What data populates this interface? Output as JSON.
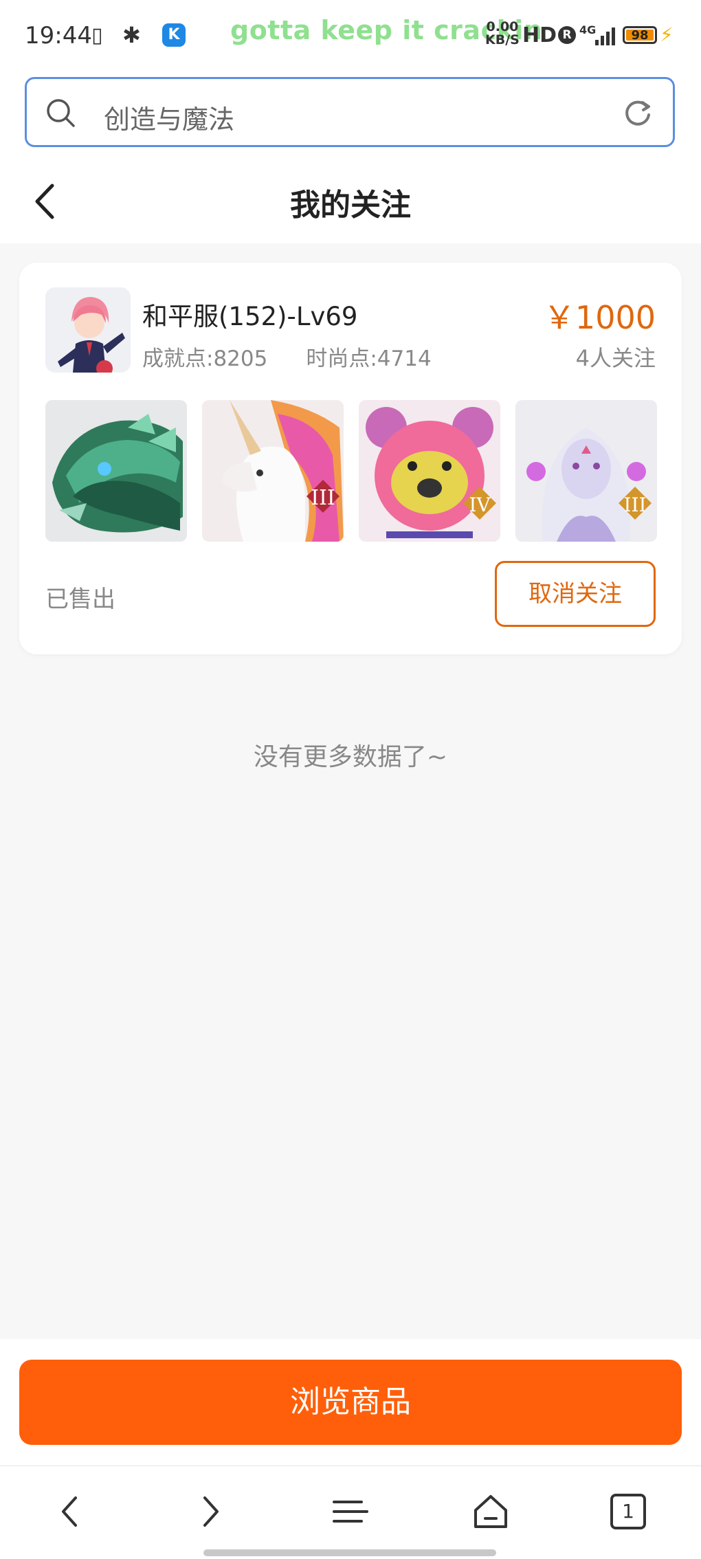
{
  "status_bar": {
    "time": "19:44",
    "lyric": "gotta keep it crackin",
    "speed_value": "0.00",
    "speed_unit": "KB/S",
    "hd": "HD",
    "roaming": "R",
    "network": "4G",
    "battery": "98",
    "app_badge": "K"
  },
  "search": {
    "value": "创造与魔法"
  },
  "header": {
    "title": "我的关注"
  },
  "listing": {
    "server": "和平服(152)-Lv69",
    "achievement": "成就点:8205",
    "fashion": "时尚点:4714",
    "price": "￥1000",
    "followers": "4人关注",
    "status": "已售出",
    "unfollow_label": "取消关注",
    "items": [
      {
        "name": "dragon",
        "badge": ""
      },
      {
        "name": "unicorn",
        "badge": "III"
      },
      {
        "name": "pink-bear",
        "badge": "IV"
      },
      {
        "name": "spirit-girl",
        "badge": "III"
      }
    ]
  },
  "footer_text": "没有更多数据了~",
  "browse_button": "浏览商品",
  "nav": {
    "tabs_count": "1"
  },
  "colors": {
    "accent": "#ff5f0a",
    "price": "#e0670e",
    "search_border": "#5b8fe0"
  }
}
